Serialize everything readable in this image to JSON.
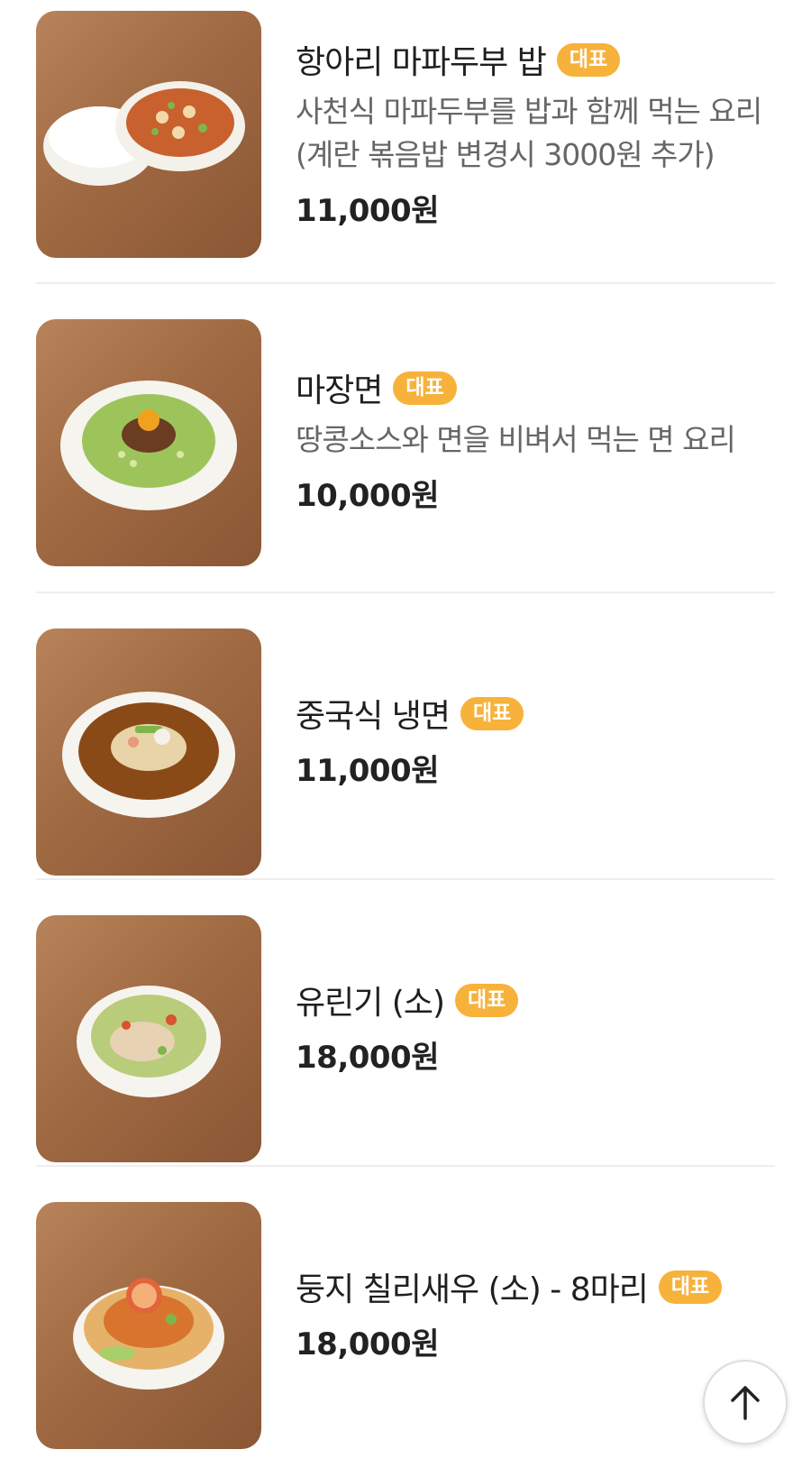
{
  "badge_label": "대표",
  "badge_color": "#f7b23b",
  "menu": {
    "items": [
      {
        "name": "항아리 마파두부 밥",
        "description": "사천식 마파두부를 밥과 함께 먹는 요리 (계란 볶음밥 변경시 3000원 추가)",
        "price": "11,000원",
        "image_icon": "mapo-tofu-bowl-image"
      },
      {
        "name": "마장면",
        "description": "땅콩소스와 면을 비벼서 먹는 면 요리",
        "price": "10,000원",
        "image_icon": "majang-noodle-image"
      },
      {
        "name": "중국식 냉면",
        "description": "",
        "price": "11,000원",
        "image_icon": "cold-noodle-image"
      },
      {
        "name": "유린기 (소)",
        "description": "",
        "price": "18,000원",
        "image_icon": "yuringi-image"
      },
      {
        "name": "둥지 칠리새우 (소) - 8마리",
        "description": "",
        "price": "18,000원",
        "image_icon": "chili-shrimp-image"
      }
    ]
  },
  "scroll_top": {
    "icon": "arrow-up-icon"
  }
}
